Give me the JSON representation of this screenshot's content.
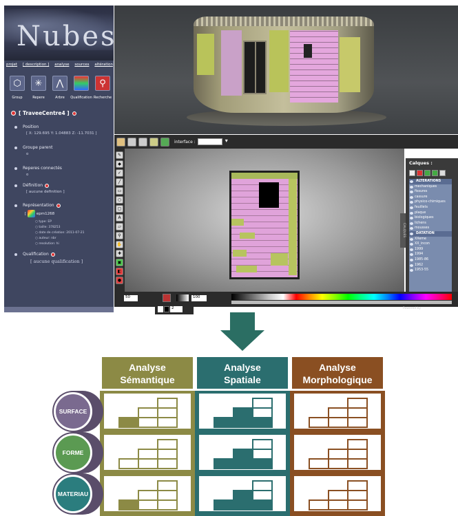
{
  "app": {
    "logo_text": "Nubes",
    "nav_links": [
      "projet",
      "[ description ]",
      "analyse",
      "sources",
      "altération"
    ],
    "tools": [
      {
        "label": "Group",
        "icon": "group-icon"
      },
      {
        "label": "Repere",
        "icon": "marker-icon"
      },
      {
        "label": "Arbre",
        "icon": "tree-icon"
      },
      {
        "label": "Qualification",
        "icon": "qualification-icon"
      },
      {
        "label": "Recherche",
        "icon": "search-icon"
      }
    ],
    "entity_title": "[ TraveeCentre4 ]",
    "properties": {
      "position_label": "Position",
      "position_value": "[ X: 129.695 Y: 1.04883 Z: -11.7031 ]",
      "parent_label": "Groupe parent",
      "parent_value": "o",
      "connected_label": "Reperes connectés",
      "connected_value": "o",
      "definition_label": "Définition",
      "definition_value": "[ aucune definition ]",
      "representation_label": "Représentation",
      "representation_file": "epm1268",
      "representation_meta": [
        "type: EP",
        "taille: 378253",
        "date de création: 2011-07-21",
        "auteur: nbr",
        "resolution: hi"
      ],
      "qualification_label": "Qualification",
      "qualification_value": "[ aucune qualification ]"
    },
    "interface_label": "interface :",
    "zoom_value": "50",
    "opacity_value": "100",
    "size_value": "2",
    "powered_by": "Powered by",
    "layers": {
      "title": "Calques :",
      "tab_label": "CALQUES",
      "items": [
        {
          "label": "ALTERATIONS",
          "group": true
        },
        {
          "label": "mechaniques",
          "group": false
        },
        {
          "label": "fissures",
          "group": false
        },
        {
          "label": "cassure",
          "group": false
        },
        {
          "label": "physico-chimiques",
          "group": false
        },
        {
          "label": "feuillets",
          "group": false
        },
        {
          "label": "plaque",
          "group": false
        },
        {
          "label": "biologiques",
          "group": false
        },
        {
          "label": "lichens",
          "group": false
        },
        {
          "label": "mousses",
          "group": false
        },
        {
          "label": "DATATION",
          "group": true
        },
        {
          "label": "XXeme",
          "group": false
        },
        {
          "label": "XX_incon",
          "group": false
        },
        {
          "label": "1999",
          "group": false
        },
        {
          "label": "1994",
          "group": false
        },
        {
          "label": "1985-86",
          "group": false
        },
        {
          "label": "1962",
          "group": false
        },
        {
          "label": "1953-55",
          "group": false
        }
      ]
    }
  },
  "analysis": {
    "columns": [
      {
        "line1": "Analyse",
        "line2": "Sémantique",
        "color": "#8c8a45"
      },
      {
        "line1": "Analyse",
        "line2": "Spatiale",
        "color": "#2b6e6f"
      },
      {
        "line1": "Analyse",
        "line2": "Morphologique",
        "color": "#8a4f22"
      }
    ],
    "rows": [
      {
        "label": "SURFACE",
        "color": "#7a6a8f"
      },
      {
        "label": "FORME",
        "color": "#5b9a52"
      },
      {
        "label": "MATERIAU",
        "color": "#2b7d7e"
      }
    ],
    "filled_levels": [
      [
        1,
        3,
        0
      ],
      [
        0,
        3,
        0
      ],
      [
        1,
        3,
        0
      ]
    ]
  }
}
